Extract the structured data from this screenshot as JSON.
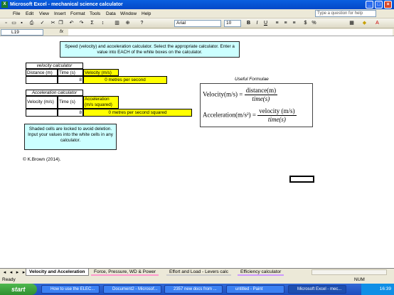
{
  "window": {
    "title": "Microsoft Excel - mechanical science calculator",
    "minimize": "_",
    "restore": "□",
    "close": "×"
  },
  "menu": {
    "items": [
      "File",
      "Edit",
      "View",
      "Insert",
      "Format",
      "Tools",
      "Data",
      "Window",
      "Help"
    ],
    "ask_placeholder": "Type a question for help"
  },
  "toolbar": {
    "font": "Arial",
    "size": "10"
  },
  "formula_bar": {
    "cell_ref": "L19",
    "fx": "fx",
    "content": ""
  },
  "sheet": {
    "info_box": "Speed (velocity) and acceleration calculator. Select the appropriate calculator. Enter a value into EACH of the white boxes on the calculator.",
    "velocity": {
      "title": "velocity calculator",
      "headers": [
        "Distance (m)",
        "Time (s)",
        "Velocity (m/s)"
      ],
      "distance": "",
      "time": "8",
      "result": "0 metres per second"
    },
    "acceleration": {
      "title": "Acceleration calculator",
      "headers": [
        "Velocity (m/s)",
        "Time (s)",
        "Acceleration (m/s squared)"
      ],
      "velocity": "",
      "time": "8",
      "result": "0 metres per second squared"
    },
    "formulae": {
      "title": "Useful Formulae",
      "v_label": "Velocity(m/s) =",
      "v_num": "distance(m)",
      "v_den": "time(s)",
      "a_label": "Acceleration(m/s²) =",
      "a_num": "velocity (m/s)",
      "a_den": "time(s)"
    },
    "note": "Shaded cells are locked to avoid deletion. Input your values into the white cells in any calculator.",
    "copyright": "© K.Brown (2014)."
  },
  "tabs": {
    "items": [
      "Velocity and Acceleration",
      "Force, Pressure, WD & Power",
      "Effort and Load - Levers calc",
      "Efficiency calculator"
    ],
    "colors": [
      "#ffffff",
      "#ff99cc",
      "#cccccc",
      "#cc99ff"
    ]
  },
  "status": {
    "left": "Ready",
    "num": "NUM"
  },
  "taskbar": {
    "start": "start",
    "tasks": [
      "How to use the ELEC...",
      "Document2 - Microsof...",
      "2357 new docs from ...",
      "untitled - Paint",
      "Microsoft Excel - mec..."
    ],
    "clock": "16:39"
  }
}
